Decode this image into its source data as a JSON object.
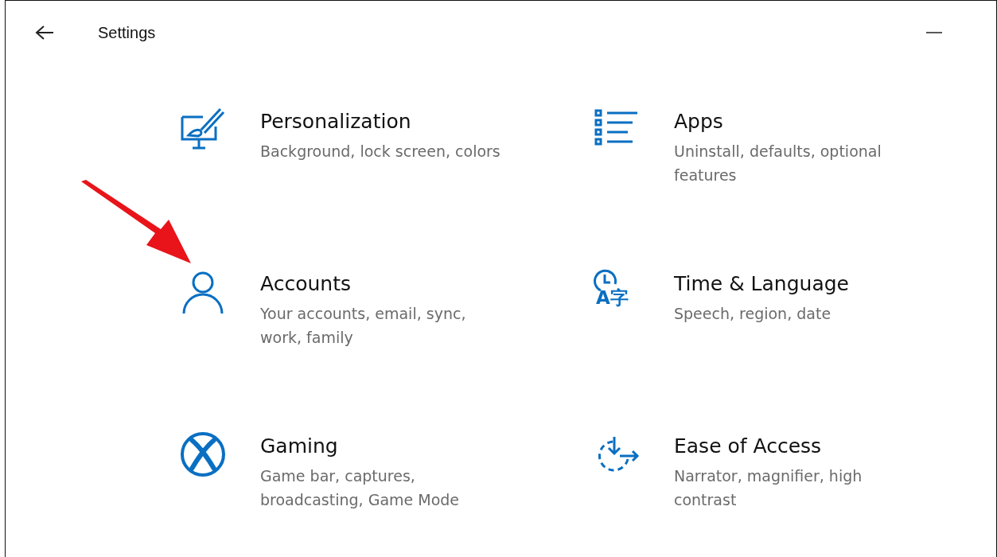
{
  "window": {
    "title": "Settings"
  },
  "categories": [
    {
      "kind": "personalization",
      "title": "Personalization",
      "description": "Background, lock screen, colors"
    },
    {
      "kind": "apps",
      "title": "Apps",
      "description": "Uninstall, defaults, optional features"
    },
    {
      "kind": "accounts",
      "title": "Accounts",
      "description": "Your accounts, email, sync, work, family"
    },
    {
      "kind": "time",
      "title": "Time & Language",
      "description": "Speech, region, date",
      "icon_text": "A字"
    },
    {
      "kind": "gaming",
      "title": "Gaming",
      "description": "Game bar, captures, broadcasting, Game Mode"
    },
    {
      "kind": "ease",
      "title": "Ease of Access",
      "description": "Narrator, magnifier, high contrast"
    }
  ]
}
